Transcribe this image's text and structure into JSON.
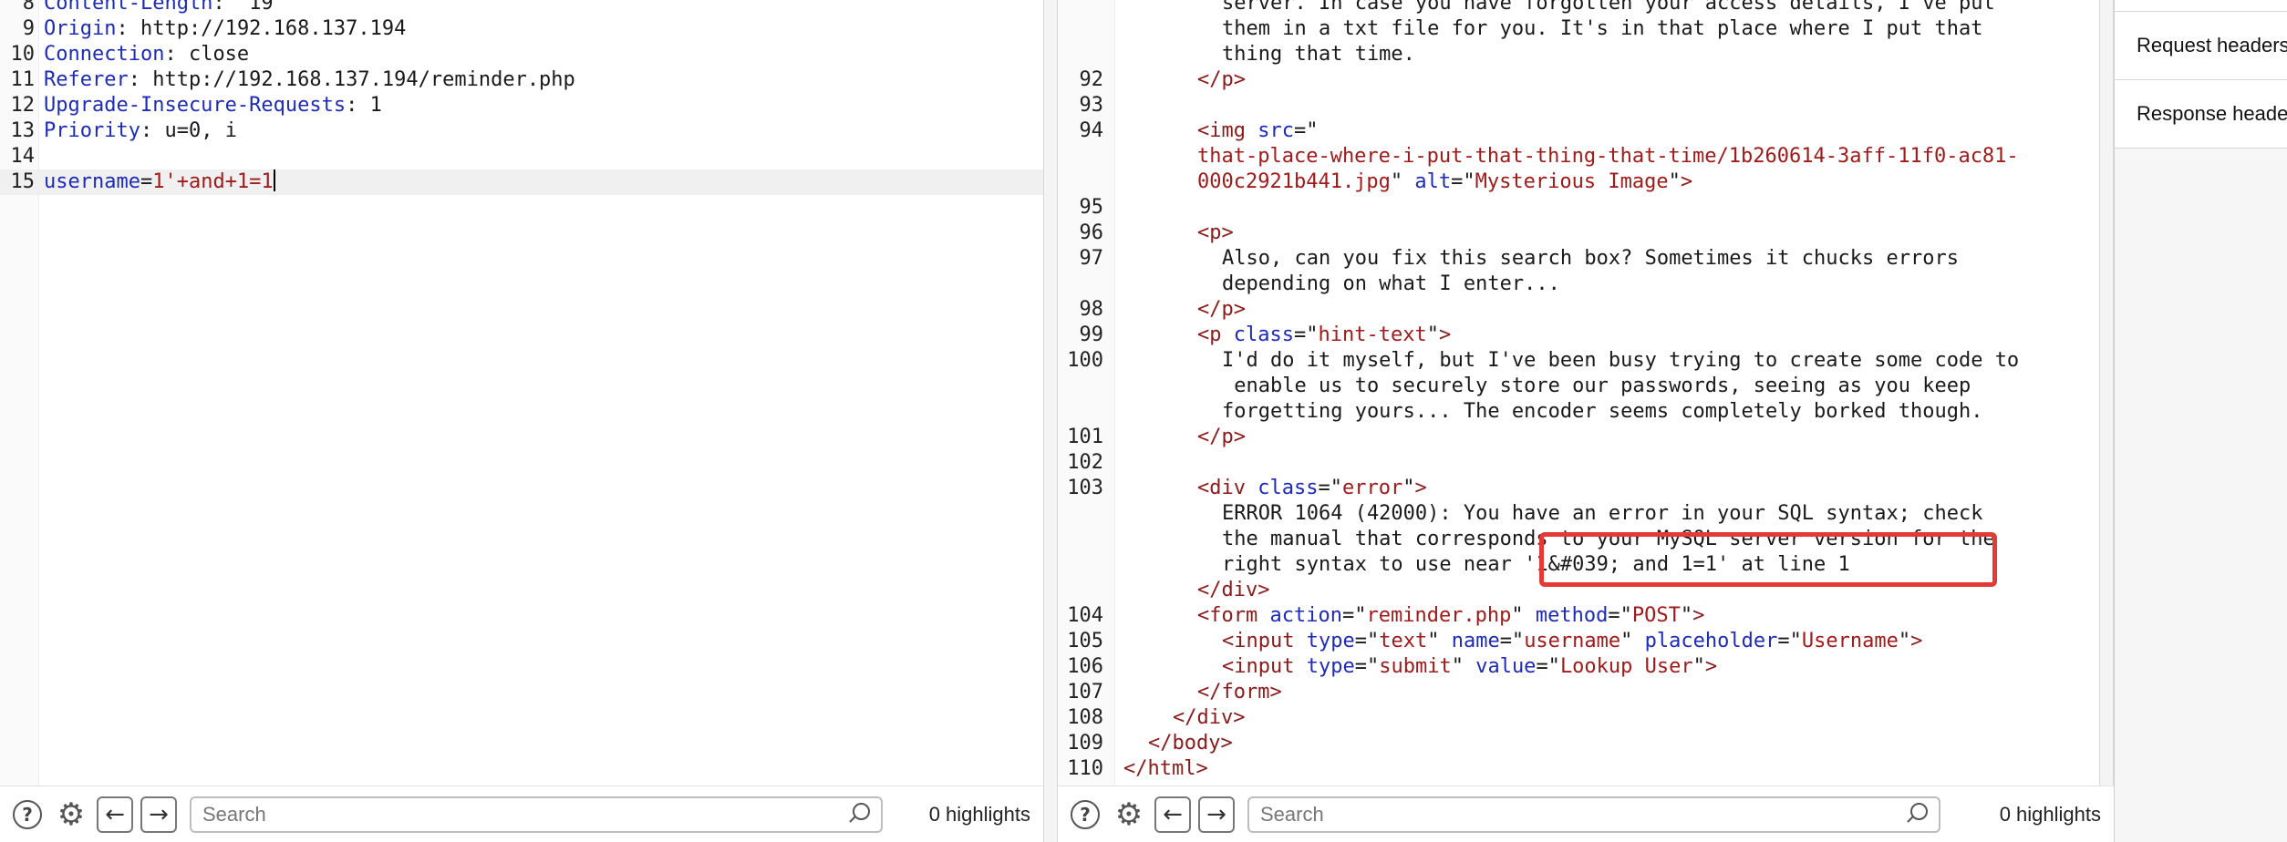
{
  "request": {
    "lines": [
      {
        "n": "8",
        "name": "Content-Length",
        "value": " 19"
      },
      {
        "n": "9",
        "name": "Origin",
        "value": " http://192.168.137.194"
      },
      {
        "n": "10",
        "name": "Connection",
        "value": " close"
      },
      {
        "n": "11",
        "name": "Referer",
        "value": " http://192.168.137.194/reminder.php"
      },
      {
        "n": "12",
        "name": "Upgrade-Insecure-Requests",
        "value": " 1"
      },
      {
        "n": "13",
        "name": "Priority",
        "value": " u=0, i"
      },
      {
        "n": "14"
      },
      {
        "n": "15",
        "param": "username",
        "param_value": "1'+and+1=1"
      }
    ]
  },
  "response": {
    "lines": [
      {
        "n": "",
        "text": "server. In case you have forgotten your access details, I've put"
      },
      {
        "n": "",
        "text": "them in a txt file for you. It's in that place where I put that"
      },
      {
        "n": "",
        "text": "thing that time."
      },
      {
        "n": "92",
        "close": "p"
      },
      {
        "n": "93"
      },
      {
        "n": "94",
        "img_src_attr": "src",
        "img_alt_attr": "alt",
        "img_src_1": "that-place-where-i-put-that-thing-that-time/1b260614-3aff-11f0-ac81-",
        "img_src_2": "000c2921b441.jpg",
        "img_alt": "Mysterious Image"
      },
      {
        "n": "95"
      },
      {
        "n": "96",
        "open": "p"
      },
      {
        "n": "97",
        "text": "Also, can you fix this search box? Sometimes it chucks errors"
      },
      {
        "n": "",
        "text": "depending on what I enter..."
      },
      {
        "n": "98",
        "close": "p"
      },
      {
        "n": "99",
        "p_class_attr": "class",
        "p_class": "hint-text"
      },
      {
        "n": "100",
        "text": "I'd do it myself, but I've been busy trying to create some code to"
      },
      {
        "n": "",
        "text": " enable us to securely store our passwords, seeing as you keep"
      },
      {
        "n": "",
        "text": "forgetting yours... The encoder seems completely borked though."
      },
      {
        "n": "101",
        "close": "p"
      },
      {
        "n": "102"
      },
      {
        "n": "103",
        "div_class_attr": "class",
        "div_class": "error"
      },
      {
        "n": "",
        "text": "ERROR 1064 (42000): You have an error in your SQL syntax; check"
      },
      {
        "n": "",
        "text": "the manual that corresponds to your MySQL server version for the"
      },
      {
        "n": "",
        "text": "right syntax to use near '1&#039; and 1=1' at line 1"
      },
      {
        "n": "",
        "close": "div"
      },
      {
        "n": "104",
        "form_action_attr": "action",
        "form_action": "reminder.php",
        "form_method_attr": "method",
        "form_method": "POST"
      },
      {
        "n": "105",
        "input1_type": "text",
        "input1_name": "username",
        "input1_placeholder": "Username"
      },
      {
        "n": "106",
        "input2_type": "submit",
        "input2_value": "Lookup User"
      },
      {
        "n": "107",
        "close": "form"
      },
      {
        "n": "108",
        "close": "div"
      },
      {
        "n": "109",
        "close": "body"
      },
      {
        "n": "110",
        "close": "html"
      }
    ]
  },
  "toolbar": {
    "help_glyph": "?",
    "gear_glyph": "⚙",
    "back_glyph": "←",
    "forward_glyph": "→",
    "search_placeholder": "Search",
    "highlights_label": "0 highlights"
  },
  "inspector": {
    "items": [
      "Request headers",
      "Response headers"
    ]
  },
  "colors": {
    "header_name": "#1d2bb8",
    "tag": "#8b1a1a",
    "string": "#a11a1a",
    "annotation_box": "#e53935"
  }
}
